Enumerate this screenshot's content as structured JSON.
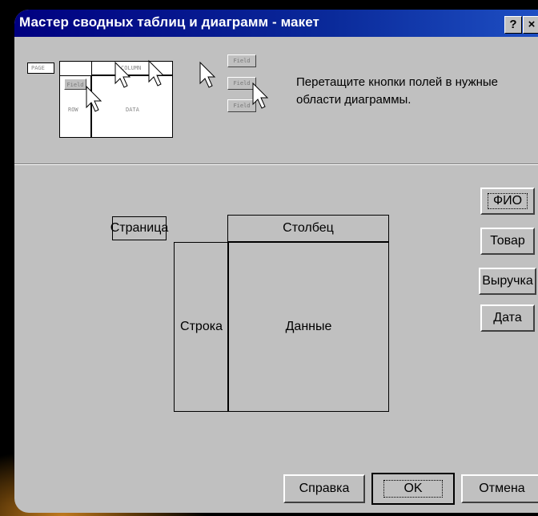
{
  "window": {
    "title": "Мастер сводных таблиц и диаграмм - макет",
    "help_button": "?",
    "close_button": "×"
  },
  "instructions": "Перетащите кнопки полей в нужные области диаграммы.",
  "preview": {
    "labels": {
      "page": "PAGE",
      "column": "COLUMN",
      "row": "ROW",
      "data": "DATA",
      "field1": "Field",
      "field2": "Field",
      "field3": "Field"
    }
  },
  "layout": {
    "page_area": "Страница",
    "column_area": "Столбец",
    "row_area": "Строка",
    "data_area": "Данные"
  },
  "fields": [
    {
      "label": "ФИО"
    },
    {
      "label": "Товар"
    },
    {
      "label": "Выручка"
    },
    {
      "label": "Дата"
    }
  ],
  "buttons": {
    "help": "Справка",
    "ok": "OK",
    "cancel": "Отмена"
  },
  "colors": {
    "title_bar": "#000080",
    "dialog_bg": "#c0c0c0"
  }
}
